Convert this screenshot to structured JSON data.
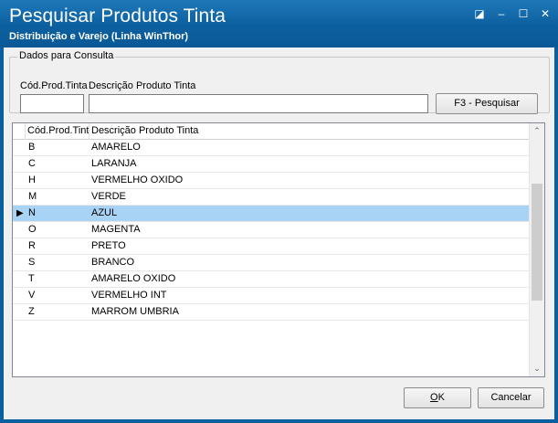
{
  "window": {
    "title": "Pesquisar Produtos Tinta",
    "subtitle": "Distribuição e Varejo (Linha WinThor)",
    "controls": {
      "edit": "◪",
      "minimize": "–",
      "maximize": "☐",
      "close": "✕"
    }
  },
  "filter": {
    "group_label": "Dados para Consulta",
    "code_label": "Cód.Prod.Tinta",
    "desc_label": "Descrição Produto Tinta",
    "code_value": "",
    "desc_value": "",
    "search_button": "F3 - Pesquisar"
  },
  "grid": {
    "columns": {
      "code": "Cód.Prod.Tint",
      "description": "Descrição Produto Tinta"
    },
    "selected_index": 4,
    "current_row_marker": "▶",
    "rows": [
      {
        "code": "B",
        "description": "AMARELO"
      },
      {
        "code": "C",
        "description": "LARANJA"
      },
      {
        "code": "H",
        "description": "VERMELHO OXIDO"
      },
      {
        "code": "M",
        "description": "VERDE"
      },
      {
        "code": "N",
        "description": "AZUL"
      },
      {
        "code": "O",
        "description": "MAGENTA"
      },
      {
        "code": "R",
        "description": "PRETO"
      },
      {
        "code": "S",
        "description": "BRANCO"
      },
      {
        "code": "T",
        "description": "AMARELO OXIDO"
      },
      {
        "code": "V",
        "description": "VERMELHO INT"
      },
      {
        "code": "Z",
        "description": "MARROM UMBRIA"
      }
    ],
    "scroll": {
      "up": "⌃",
      "down": "⌄"
    }
  },
  "footer": {
    "ok_accel": "O",
    "ok_rest": "K",
    "cancel_button": "Cancelar"
  },
  "colors": {
    "titlebar": "#0c5f9f",
    "selected_row": "#a9d3f5"
  }
}
